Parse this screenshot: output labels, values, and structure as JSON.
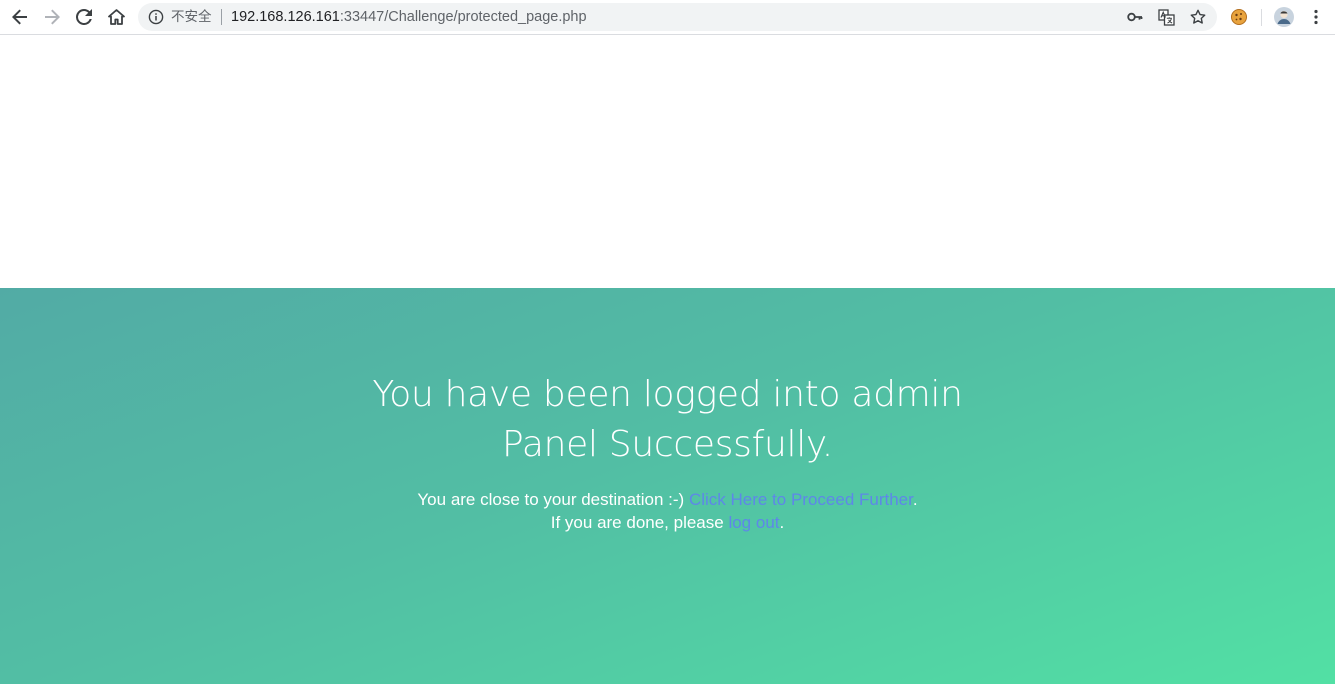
{
  "browser": {
    "security_label": "不安全",
    "url_host": "192.168.126.161",
    "url_rest": ":33447/Challenge/protected_page.php",
    "icons": {
      "back": "arrow-left-icon",
      "forward": "arrow-right-icon",
      "reload": "reload-icon",
      "home": "home-icon",
      "info": "info-icon",
      "key": "key-icon",
      "translate": "translate-icon",
      "bookmark": "star-icon",
      "extension": "cookie-icon",
      "profile": "avatar-icon",
      "menu": "kebab-menu-icon"
    }
  },
  "hero": {
    "title_line1": "You have been logged into admin",
    "title_line2": "Panel Successfully.",
    "line1_prefix": "You are close to your destination :-) ",
    "line1_link": "Click Here to Proceed Further",
    "line1_suffix": ".",
    "line2_prefix": "If you are done, please ",
    "line2_link": "log out",
    "line2_suffix": ".",
    "colors": {
      "gradient_start": "#52aba5",
      "gradient_end": "#52e0a4",
      "link": "#5e87e8",
      "text": "#ffffff"
    }
  }
}
